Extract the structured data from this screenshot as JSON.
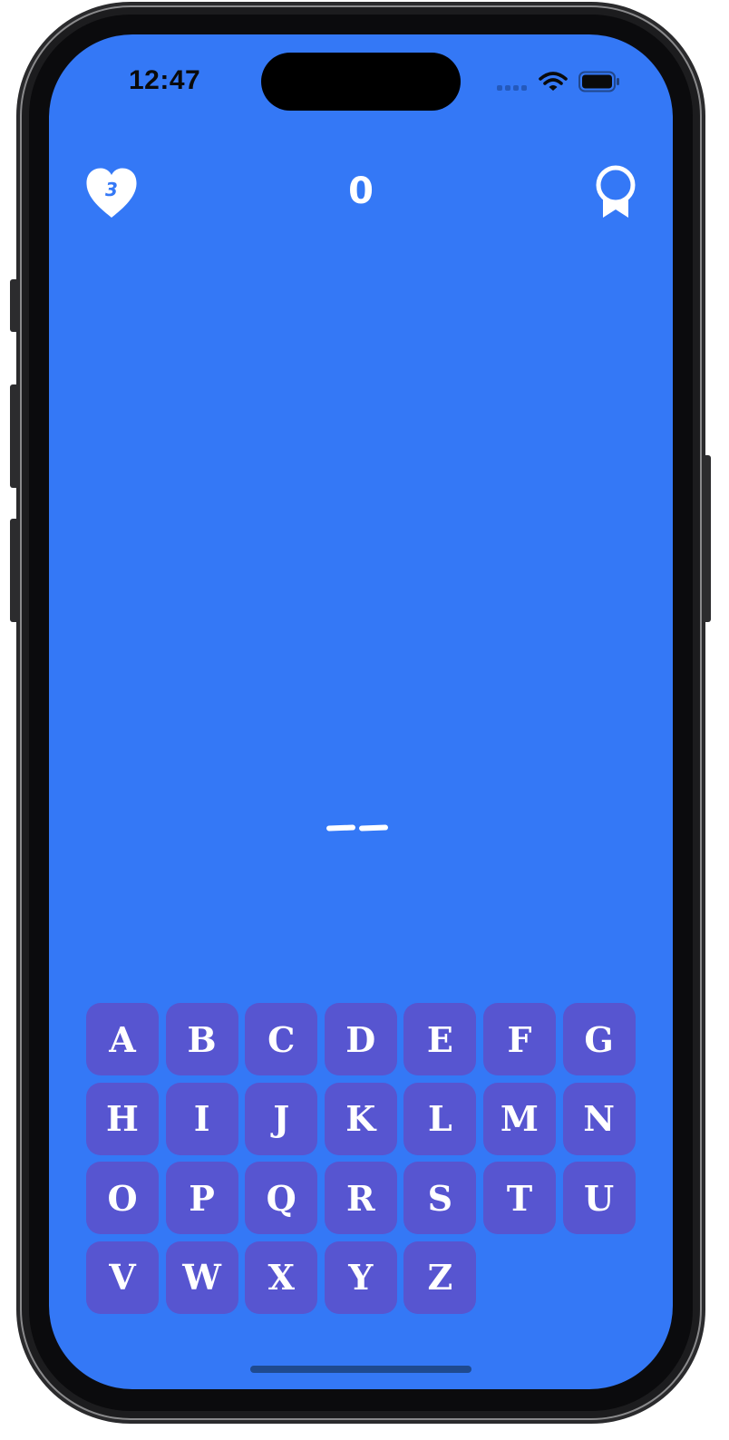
{
  "status_bar": {
    "time": "12:47",
    "wifi_icon": "wifi-icon",
    "battery_icon": "battery-icon"
  },
  "hud": {
    "lives": "3",
    "lives_icon": "heart-icon",
    "score": "0",
    "achievements_icon": "award-ribbon-icon"
  },
  "word": {
    "slots": 2
  },
  "keyboard": {
    "keys": [
      "A",
      "B",
      "C",
      "D",
      "E",
      "F",
      "G",
      "H",
      "I",
      "J",
      "K",
      "L",
      "M",
      "N",
      "O",
      "P",
      "Q",
      "R",
      "S",
      "T",
      "U",
      "V",
      "W",
      "X",
      "Y",
      "Z"
    ]
  },
  "colors": {
    "background": "#3478F6",
    "key_background": "#5755D0",
    "foreground": "#FFFFFF"
  }
}
